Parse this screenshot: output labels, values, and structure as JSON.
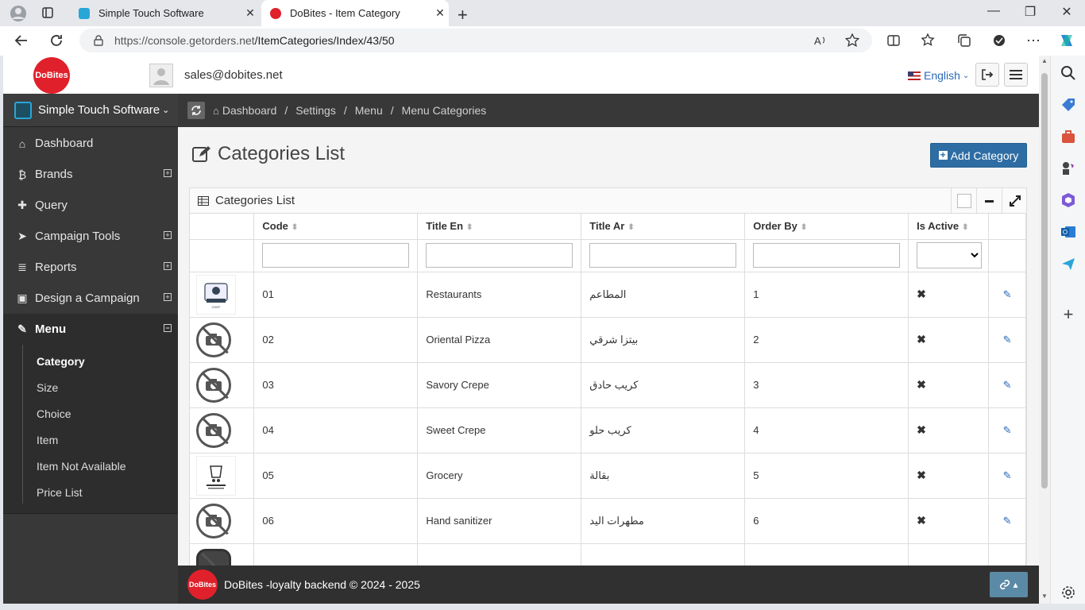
{
  "browser": {
    "tabs": [
      {
        "title": "Simple Touch Software"
      },
      {
        "title": "DoBites - Item Category"
      }
    ],
    "url_host": "https://console.getorders.net",
    "url_path": "/ItemCategories/Index/43/50"
  },
  "header": {
    "logo_text": "DoBites",
    "email": "sales@dobites.net",
    "language": "English"
  },
  "sidebar": {
    "org_name": "Simple Touch Software",
    "items": [
      {
        "label": "Dashboard",
        "icon": "home-icon"
      },
      {
        "label": "Brands",
        "icon": "bitcoin-icon"
      },
      {
        "label": "Query",
        "icon": "puzzle-icon"
      },
      {
        "label": "Campaign Tools",
        "icon": "send-icon"
      },
      {
        "label": "Reports",
        "icon": "database-icon"
      },
      {
        "label": "Design a Campaign",
        "icon": "briefcase-icon"
      },
      {
        "label": "Menu",
        "icon": "edit-icon"
      }
    ],
    "menu_sub": [
      "Category",
      "Size",
      "Choice",
      "Item",
      "Item Not Available",
      "Price List"
    ]
  },
  "breadcrumb": [
    "Dashboard",
    "Settings",
    "Menu",
    "Menu Categories"
  ],
  "page": {
    "title": "Categories List",
    "add_button": "Add Category",
    "widget_title": "Categories List"
  },
  "table": {
    "columns": [
      "Code",
      "Title En",
      "Title Ar",
      "Order By",
      "Is Active"
    ],
    "rows": [
      {
        "code": "01",
        "title_en": "Restaurants",
        "title_ar": "المطاعم",
        "order": "1",
        "image": "restaurant-logo"
      },
      {
        "code": "02",
        "title_en": "Oriental Pizza",
        "title_ar": "بيتزا شرقي",
        "order": "2",
        "image": "no-image"
      },
      {
        "code": "03",
        "title_en": "Savory Crepe",
        "title_ar": "كريب حادق",
        "order": "3",
        "image": "no-image"
      },
      {
        "code": "04",
        "title_en": "Sweet Crepe",
        "title_ar": "كريب حلو",
        "order": "4",
        "image": "no-image"
      },
      {
        "code": "05",
        "title_en": "Grocery",
        "title_ar": "بقالة",
        "order": "5",
        "image": "grocery-logo"
      },
      {
        "code": "06",
        "title_en": "Hand sanitizer",
        "title_ar": "مطهرات اليد",
        "order": "6",
        "image": "no-image"
      }
    ]
  },
  "footer": {
    "logo_text": "DoBites",
    "text": "DoBites -loyalty backend © 2024 - 2025"
  },
  "colors": {
    "brand_red": "#e0202a",
    "primary_blue": "#2e6da4",
    "sidebar_dark": "#383838"
  }
}
